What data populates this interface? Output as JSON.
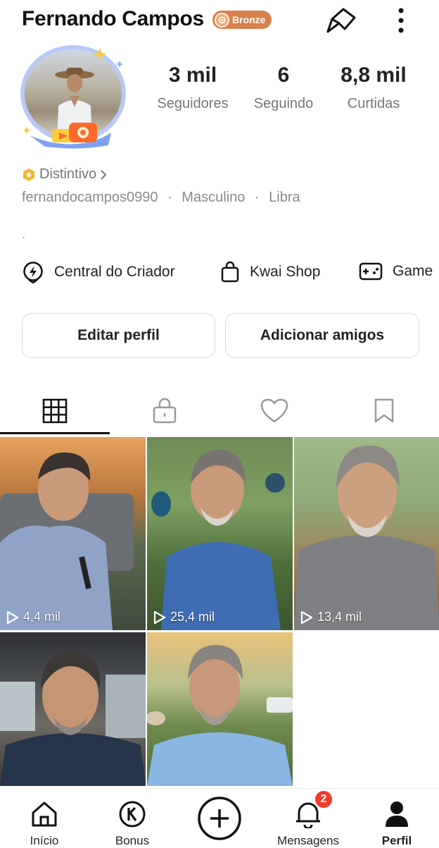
{
  "profile": {
    "name": "Fernando Campos",
    "badge": "Bronze",
    "distintivo": "Distintivo",
    "handle": "fernandocampos0990",
    "gender": "Masculino",
    "sign": "Libra",
    "separator": "·",
    "bio": "."
  },
  "stats": [
    {
      "value": "3 mil",
      "label": "Seguidores"
    },
    {
      "value": "6",
      "label": "Seguindo"
    },
    {
      "value": "8,8 mil",
      "label": "Curtidas"
    }
  ],
  "quick_links": [
    {
      "label": "Central do Criador",
      "icon": "lightning-icon"
    },
    {
      "label": "Kwai Shop",
      "icon": "shopping-bag-icon"
    },
    {
      "label": "Game",
      "icon": "gamepad-icon"
    }
  ],
  "buttons": {
    "edit": "Editar perfil",
    "add_friends": "Adicionar amigos"
  },
  "tabs": [
    {
      "icon": "grid-icon",
      "active": true
    },
    {
      "icon": "lock-icon",
      "active": false
    },
    {
      "icon": "heart-icon",
      "active": false
    },
    {
      "icon": "bookmark-icon",
      "active": false
    }
  ],
  "videos": [
    {
      "views": "4,4 mil"
    },
    {
      "views": "25,4 mil"
    },
    {
      "views": "13,4 mil"
    },
    {
      "views": ""
    },
    {
      "views": ""
    }
  ],
  "nav": {
    "home": "Início",
    "bonus": "Bonus",
    "messages": "Mensagens",
    "messages_badge": "2",
    "profile": "Perfil"
  },
  "colors": {
    "bronze": "#d9814c",
    "notification": "#f03a2e",
    "text_muted": "#777777"
  }
}
